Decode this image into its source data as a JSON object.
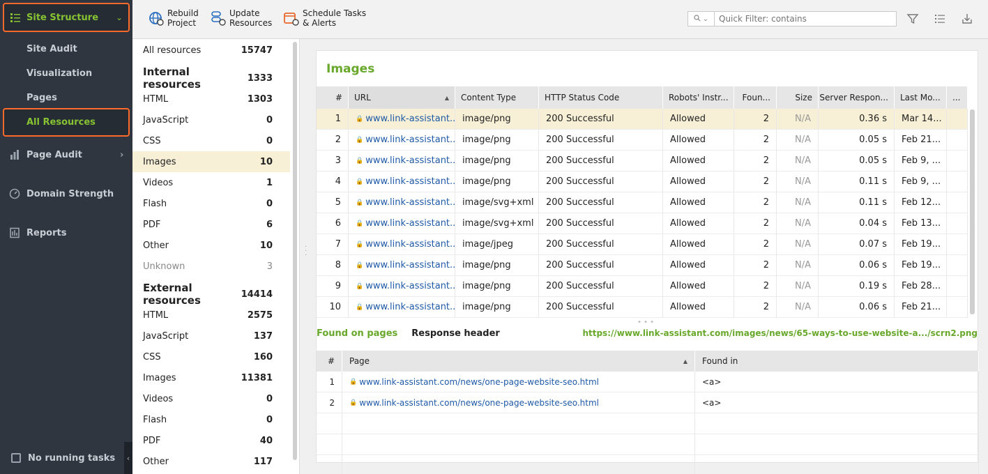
{
  "sidebar": {
    "section_title": "Site Structure",
    "sub_items": [
      "Site Audit",
      "Visualization",
      "Pages",
      "All Resources"
    ],
    "main_items": [
      {
        "label": "Page Audit"
      },
      {
        "label": "Domain Strength"
      },
      {
        "label": "Reports"
      }
    ],
    "footer": "No running tasks"
  },
  "toolbar": {
    "rebuild": "Rebuild\nProject",
    "rebuild_l1": "Rebuild",
    "rebuild_l2": "Project",
    "update_l1": "Update",
    "update_l2": "Resources",
    "schedule_l1": "Schedule Tasks",
    "schedule_l2": "& Alerts",
    "filter_placeholder": "Quick Filter: contains"
  },
  "resources": {
    "all": {
      "label": "All resources",
      "count": "15747"
    },
    "internal": {
      "label": "Internal resources",
      "count": "1333",
      "items": [
        {
          "label": "HTML",
          "count": "1303"
        },
        {
          "label": "JavaScript",
          "count": "0"
        },
        {
          "label": "CSS",
          "count": "0"
        },
        {
          "label": "Images",
          "count": "10"
        },
        {
          "label": "Videos",
          "count": "1"
        },
        {
          "label": "Flash",
          "count": "0"
        },
        {
          "label": "PDF",
          "count": "6"
        },
        {
          "label": "Other",
          "count": "10"
        },
        {
          "label": "Unknown",
          "count": "3"
        }
      ]
    },
    "external": {
      "label": "External resources",
      "count": "14414",
      "items": [
        {
          "label": "HTML",
          "count": "2575"
        },
        {
          "label": "JavaScript",
          "count": "137"
        },
        {
          "label": "CSS",
          "count": "160"
        },
        {
          "label": "Images",
          "count": "11381"
        },
        {
          "label": "Videos",
          "count": "0"
        },
        {
          "label": "Flash",
          "count": "0"
        },
        {
          "label": "PDF",
          "count": "40"
        },
        {
          "label": "Other",
          "count": "117"
        }
      ]
    }
  },
  "panel": {
    "title": "Images",
    "columns": [
      "#",
      "URL",
      "Content Type",
      "HTTP Status Code",
      "Robots' Instr...",
      "Foun...",
      "Size",
      "Server Respon...",
      "Last Mo...",
      "..."
    ],
    "rows": [
      [
        "1",
        "www.link-assistant....",
        "image/png",
        "200 Successful",
        "Allowed",
        "2",
        "N/A",
        "0.36 s",
        "Mar 14..."
      ],
      [
        "2",
        "www.link-assistant....",
        "image/png",
        "200 Successful",
        "Allowed",
        "2",
        "N/A",
        "0.05 s",
        "Feb 21..."
      ],
      [
        "3",
        "www.link-assistant....",
        "image/png",
        "200 Successful",
        "Allowed",
        "2",
        "N/A",
        "0.05 s",
        "Feb 9, ..."
      ],
      [
        "4",
        "www.link-assistant....",
        "image/png",
        "200 Successful",
        "Allowed",
        "2",
        "N/A",
        "0.11 s",
        "Feb 9, ..."
      ],
      [
        "5",
        "www.link-assistant....",
        "image/svg+xml",
        "200 Successful",
        "Allowed",
        "2",
        "N/A",
        "0.11 s",
        "Feb 12..."
      ],
      [
        "6",
        "www.link-assistant....",
        "image/svg+xml",
        "200 Successful",
        "Allowed",
        "2",
        "N/A",
        "0.04 s",
        "Feb 13..."
      ],
      [
        "7",
        "www.link-assistant....",
        "image/jpeg",
        "200 Successful",
        "Allowed",
        "2",
        "N/A",
        "0.07 s",
        "Feb 19..."
      ],
      [
        "8",
        "www.link-assistant....",
        "image/png",
        "200 Successful",
        "Allowed",
        "2",
        "N/A",
        "0.06 s",
        "Feb 19..."
      ],
      [
        "9",
        "www.link-assistant....",
        "image/png",
        "200 Successful",
        "Allowed",
        "2",
        "N/A",
        "0.19 s",
        "Feb 28..."
      ],
      [
        "10",
        "www.link-assistant....",
        "image/png",
        "200 Successful",
        "Allowed",
        "2",
        "N/A",
        "0.06 s",
        "Feb 21..."
      ]
    ],
    "tabs": [
      "Found on pages",
      "Response header"
    ],
    "selected_url": "https://www.link-assistant.com/images/news/65-ways-to-use-website-a.../scrn2.png",
    "sub_columns": [
      "#",
      "Page",
      "Found in"
    ],
    "sub_rows": [
      [
        "1",
        "www.link-assistant.com/news/one-page-website-seo.html",
        "<a>"
      ],
      [
        "2",
        "www.link-assistant.com/news/one-page-website-seo.html",
        "<a>"
      ]
    ]
  },
  "colors": {
    "accent": "#86c232",
    "highlight_border": "#ff6a2b",
    "link": "#1f5aa8"
  }
}
